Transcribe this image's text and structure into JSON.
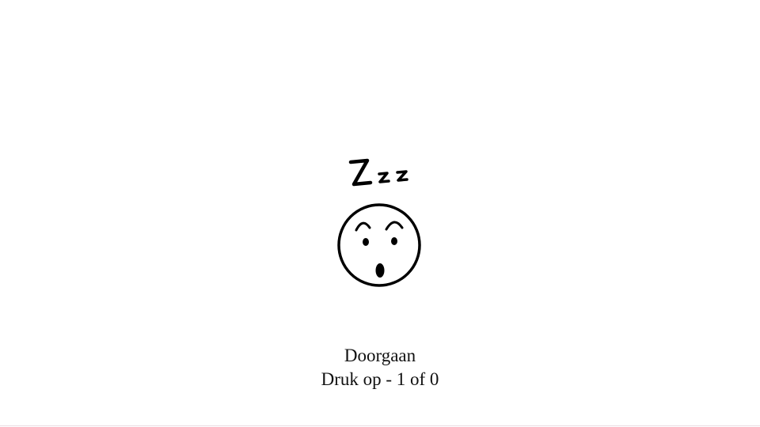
{
  "screen": {
    "illustration_icon": "sleeping-face-icon",
    "prompt_title": "Doorgaan",
    "prompt_hint": "Druk op - 1 of 0"
  },
  "colors": {
    "background": "#ffffff",
    "ink": "#000000",
    "text": "#111111",
    "bottom_line": "#eadce2"
  }
}
